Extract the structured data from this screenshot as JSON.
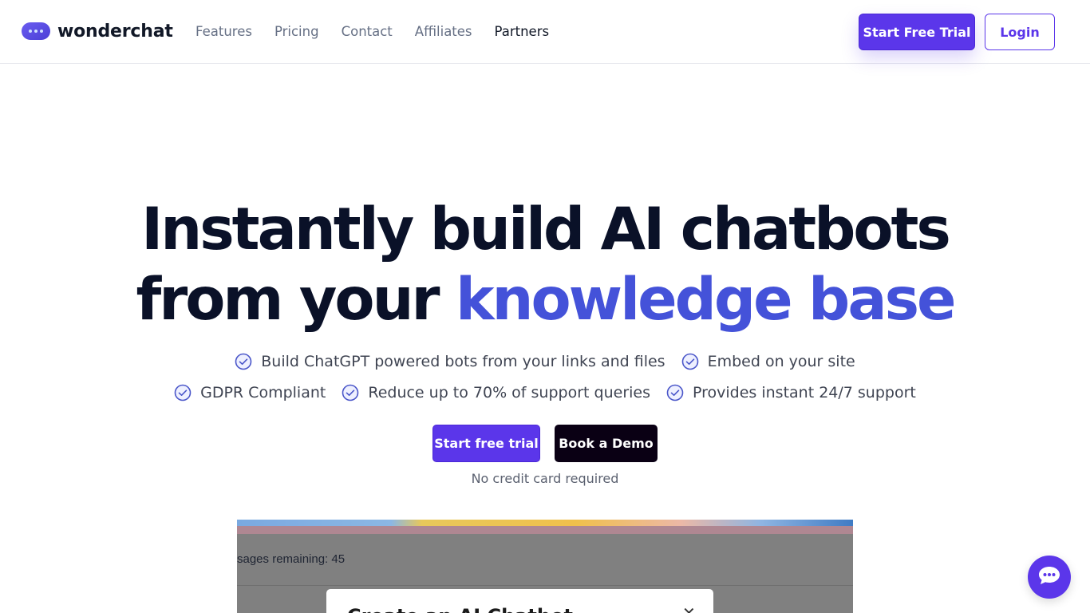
{
  "header": {
    "logo_text": "wonderchat",
    "nav": [
      "Features",
      "Pricing",
      "Contact",
      "Affiliates",
      "Partners"
    ],
    "start_trial_label": "Start Free Trial",
    "login_label": "Login"
  },
  "hero": {
    "title_line1": "Instantly build AI chatbots",
    "title_line2_plain": "from your",
    "title_line2_accent": "knowledge base",
    "features_row1": [
      "Build ChatGPT powered bots from your links and files",
      "Embed on your site"
    ],
    "features_row2": [
      "GDPR Compliant",
      "Reduce up to 70% of support queries",
      "Provides instant 24/7 support"
    ],
    "cta_primary": "Start free trial",
    "cta_secondary": "Book a Demo",
    "note": "No credit card required"
  },
  "preview": {
    "messages_text": "sages remaining: 45",
    "modal_title": "Create an AI Chatbot",
    "close_symbol": "✕"
  },
  "icons": {
    "logo": "chat-bubble-icon",
    "feature": "check-circle-icon",
    "chat_widget": "chat-dots-icon"
  },
  "colors": {
    "brand": "#5b36ea",
    "accent_text": "#4452d9",
    "dark": "#0a1128"
  }
}
